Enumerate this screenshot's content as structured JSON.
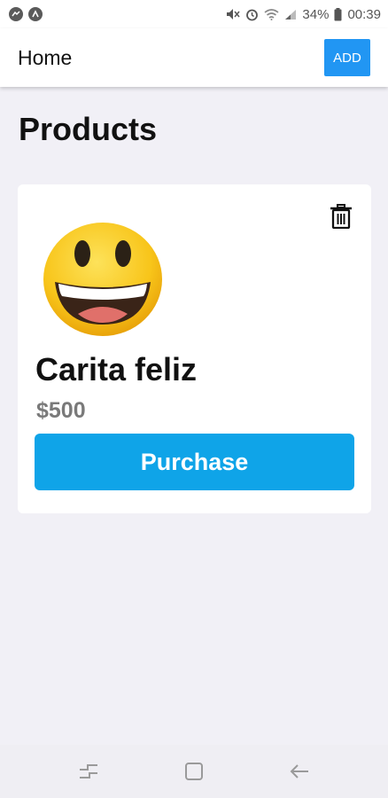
{
  "status_bar": {
    "battery_percent": "34%",
    "time": "00:39",
    "left_icons": [
      "messenger-icon",
      "notification-app-icon"
    ],
    "right_icons": [
      "mute-icon",
      "alarm-icon",
      "wifi-icon",
      "signal-icon",
      "battery-icon"
    ]
  },
  "header": {
    "title": "Home",
    "add_label": "ADD",
    "accent_color": "#2196f3"
  },
  "page": {
    "title": "Products"
  },
  "products": [
    {
      "name": "Carita feliz",
      "price": "$500",
      "image_icon": "grinning-face-emoji",
      "purchase_label": "Purchase",
      "delete_icon": "trash-icon",
      "button_color": "#0fa4e8"
    }
  ],
  "nav_bar": {
    "buttons": [
      "recent-apps-icon",
      "home-icon",
      "back-icon"
    ]
  }
}
